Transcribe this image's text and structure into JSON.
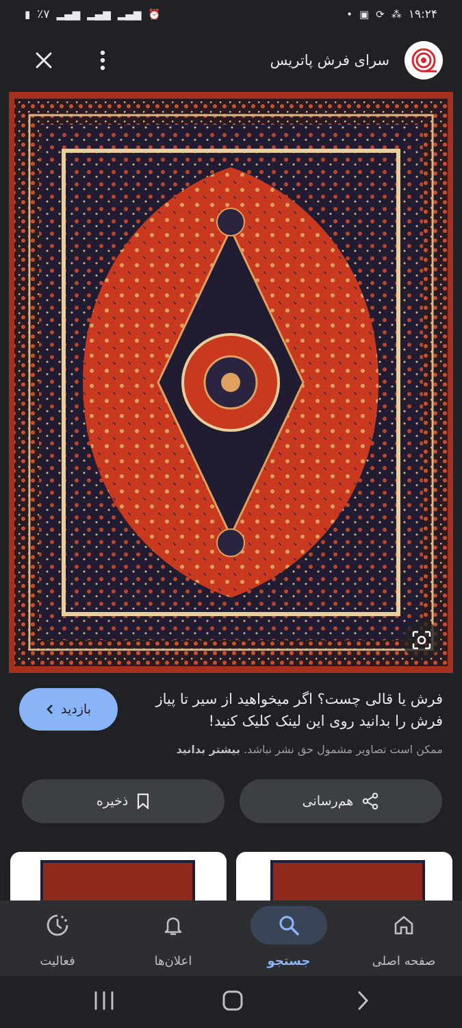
{
  "status_bar": {
    "time": "۱۹:۲۴",
    "battery": "٪۷"
  },
  "header": {
    "site_name": "سرای فرش پاتریس"
  },
  "result": {
    "visit_label": "بازدید",
    "title": "فرش یا قالی چست؟ اگر میخواهید از سیر تا پیاز فرش را بدانید روی این لینک کلیک کنید!",
    "copyright_notice": "ممکن است تصاویر مشمول حق نشر نباشد.",
    "learn_more": "بیشتر بدانید"
  },
  "actions": {
    "share_label": "هم‌رسانی",
    "save_label": "ذخیره"
  },
  "bottom_nav": {
    "items": [
      {
        "label": "صفحه اصلی",
        "icon": "home-icon"
      },
      {
        "label": "جستجو",
        "icon": "search-icon",
        "active": true
      },
      {
        "label": "اعلان‌ها",
        "icon": "bell-icon"
      },
      {
        "label": "فعالیت",
        "icon": "activity-icon"
      }
    ]
  },
  "colors": {
    "accent": "#8ab4f8",
    "background": "#202124",
    "button_bg": "#3c4043",
    "nav_bg": "#2d2e31"
  }
}
